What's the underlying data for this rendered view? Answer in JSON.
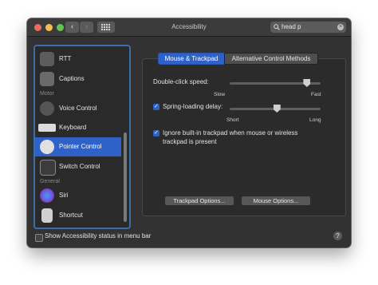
{
  "window": {
    "title": "Accessibility"
  },
  "search": {
    "value": "head p"
  },
  "toolbar": {
    "back_glyph": "‹",
    "forward_glyph": "›",
    "clear_glyph": "×"
  },
  "sidebar": {
    "items": [
      {
        "label": "RTT",
        "icon": "rtt-icon",
        "color": "#5c5c5c"
      },
      {
        "label": "Captions",
        "icon": "captions-icon",
        "color": "#6a6a6a"
      },
      {
        "label": "Voice Control",
        "icon": "voice-control-icon",
        "color": "#555555"
      },
      {
        "label": "Keyboard",
        "icon": "keyboard-icon",
        "color": "#dcdcdc"
      },
      {
        "label": "Pointer Control",
        "icon": "pointer-control-icon",
        "color": "#e0e0e0",
        "selected": true
      },
      {
        "label": "Switch Control",
        "icon": "switch-control-icon",
        "color": "#3c3c3c"
      },
      {
        "label": "Siri",
        "icon": "siri-icon",
        "color": "#7b4bd6"
      },
      {
        "label": "Shortcut",
        "icon": "shortcut-icon",
        "color": "#d0d0d0"
      }
    ],
    "headers": {
      "motor": "Motor",
      "general": "General"
    }
  },
  "tabs": {
    "mouse_trackpad": "Mouse & Trackpad",
    "alt_methods": "Alternative Control Methods"
  },
  "settings": {
    "double_click_label": "Double-click speed:",
    "double_click_min": "Slow",
    "double_click_max": "Fast",
    "double_click_value": 0.85,
    "spring_label": "Spring-loading delay:",
    "spring_checked": true,
    "spring_min": "Short",
    "spring_max": "Long",
    "spring_value": 0.52,
    "ignore_line1": "Ignore built-in trackpad when mouse or wireless",
    "ignore_line2": "trackpad is present",
    "ignore_checked": true,
    "check_glyph": "✓",
    "trackpad_options": "Trackpad Options...",
    "mouse_options": "Mouse Options..."
  },
  "footer": {
    "status_label": "Show Accessibility status in menu bar",
    "help_label": "?"
  },
  "colors": {
    "accent": "#2f62c9",
    "window_bg": "#323232"
  }
}
